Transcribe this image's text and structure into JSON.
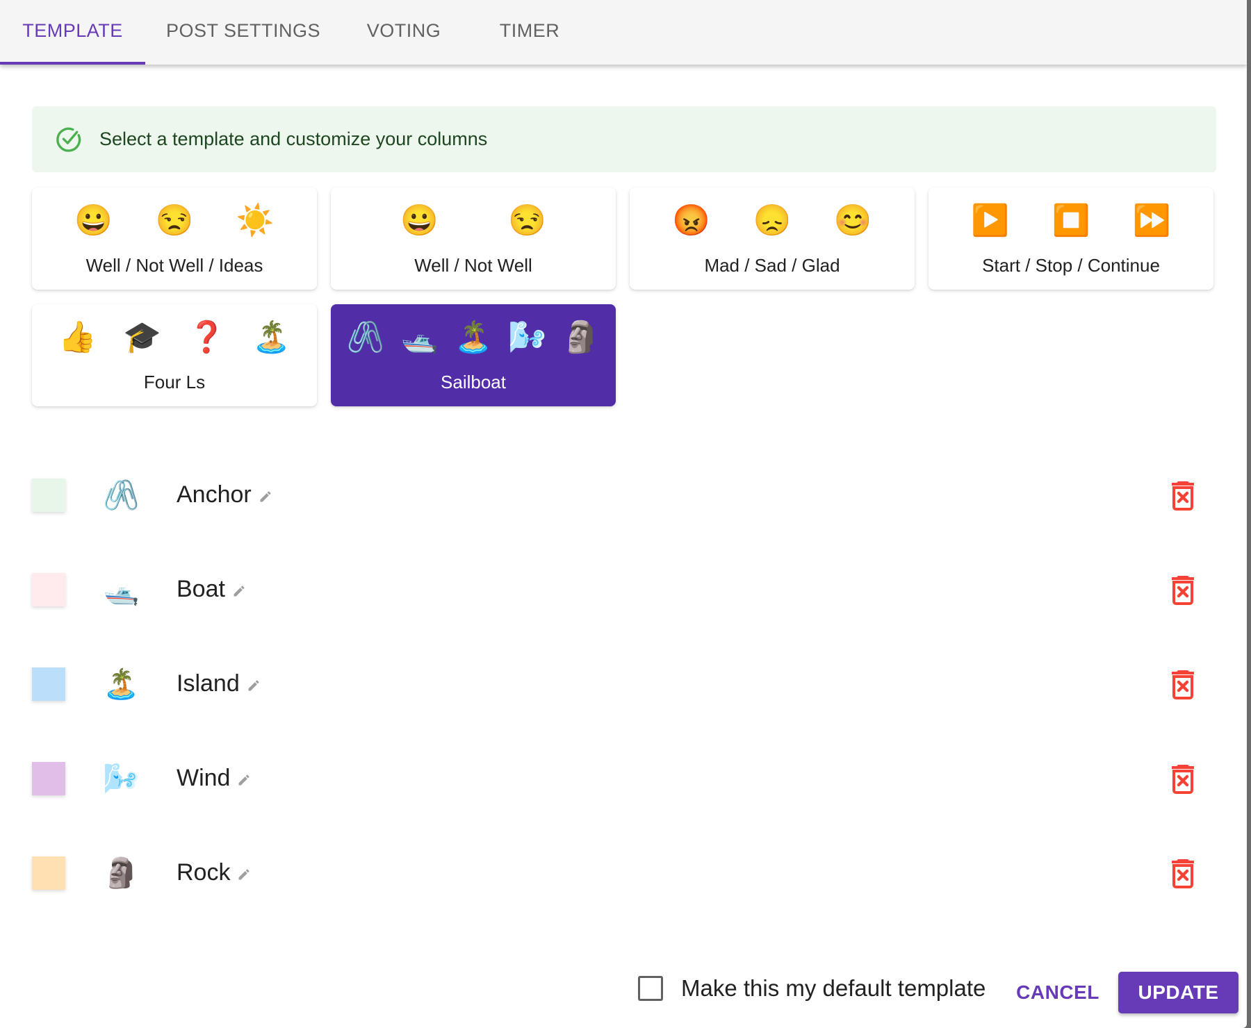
{
  "tabs": [
    {
      "label": "TEMPLATE",
      "active": true
    },
    {
      "label": "POST SETTINGS",
      "active": false
    },
    {
      "label": "VOTING",
      "active": false
    },
    {
      "label": "TIMER",
      "active": false
    }
  ],
  "alert": {
    "icon": "check-circle-icon",
    "text": "Select a template and customize your columns"
  },
  "templates": [
    {
      "label": "Well / Not Well / Ideas",
      "emojis": [
        "😀",
        "😒",
        "☀️"
      ],
      "selected": false
    },
    {
      "label": "Well / Not Well",
      "emojis": [
        "😀",
        "😒"
      ],
      "selected": false
    },
    {
      "label": "Mad / Sad / Glad",
      "emojis": [
        "😡",
        "😞",
        "😊"
      ],
      "selected": false
    },
    {
      "label": "Start / Stop / Continue",
      "emojis": [
        "▶️",
        "⏹️",
        "⏩"
      ],
      "selected": false
    },
    {
      "label": "Four Ls",
      "emojis": [
        "👍",
        "🎓",
        "❓",
        "🏝️"
      ],
      "selected": false
    },
    {
      "label": "Sailboat",
      "emojis": [
        "🖇️",
        "🛥️",
        "🏝️",
        "🌬️",
        "🗿"
      ],
      "selected": true
    }
  ],
  "columns": [
    {
      "label": "Anchor",
      "emoji": "🖇️",
      "color": "#e8f5e9"
    },
    {
      "label": "Boat",
      "emoji": "🛥️",
      "color": "#ffebee"
    },
    {
      "label": "Island",
      "emoji": "🏝️",
      "color": "#bbdefb"
    },
    {
      "label": "Wind",
      "emoji": "🌬️",
      "color": "#e1bee7"
    },
    {
      "label": "Rock",
      "emoji": "🗿",
      "color": "#ffe0b2"
    }
  ],
  "footer": {
    "default_checkbox_label": "Make this my default template",
    "default_checked": false,
    "cancel_label": "CANCEL",
    "update_label": "UPDATE"
  },
  "colors": {
    "accent": "#673ab7",
    "selected_card": "#512da8",
    "alert_bg": "#edf7ed",
    "alert_icon": "#4caf50",
    "delete": "#f44336",
    "pencil": "#9e9e9e"
  }
}
